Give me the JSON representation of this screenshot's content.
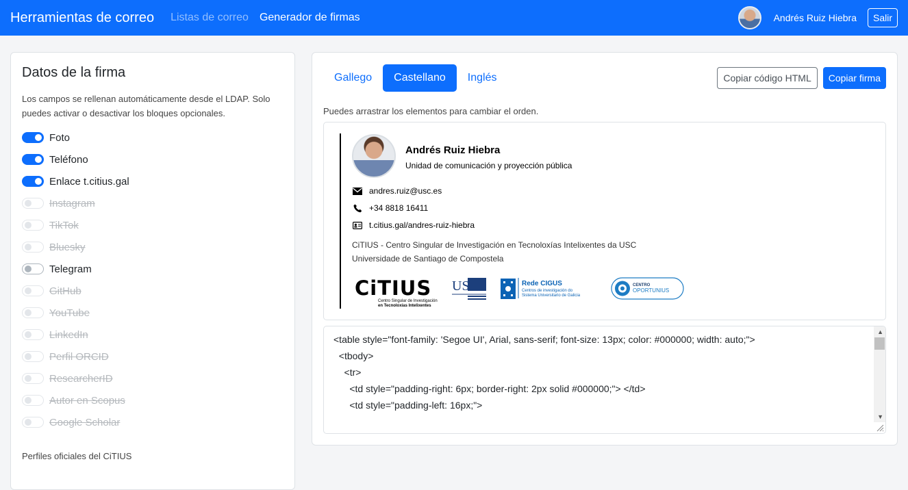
{
  "navbar": {
    "brand": "Herramientas de correo",
    "links": [
      {
        "label": "Listas de correo",
        "active": false
      },
      {
        "label": "Generador de firmas",
        "active": true
      }
    ],
    "user_name": "Andrés Ruiz Hiebra",
    "logout_label": "Salir",
    "color": "#0d6efd"
  },
  "left": {
    "title": "Datos de la firma",
    "description": "Los campos se rellenan automáticamente desde el LDAP. Solo puedes activar o desactivar los bloques opcionales.",
    "toggles": [
      {
        "label": "Foto",
        "state": "on"
      },
      {
        "label": "Teléfono",
        "state": "on"
      },
      {
        "label": "Enlace t.citius.gal",
        "state": "on"
      },
      {
        "label": "Instagram",
        "state": "disabled"
      },
      {
        "label": "TikTok",
        "state": "disabled"
      },
      {
        "label": "Bluesky",
        "state": "disabled"
      },
      {
        "label": "Telegram",
        "state": "off"
      },
      {
        "label": "GitHub",
        "state": "disabled"
      },
      {
        "label": "YouTube",
        "state": "disabled"
      },
      {
        "label": "LinkedIn",
        "state": "disabled"
      },
      {
        "label": "Perfil ORCID",
        "state": "disabled"
      },
      {
        "label": "ResearcherID",
        "state": "disabled"
      },
      {
        "label": "Autor en Scopus",
        "state": "disabled"
      },
      {
        "label": "Google Scholar",
        "state": "disabled"
      }
    ],
    "section_title": "Perfiles oficiales del CiTIUS"
  },
  "right": {
    "tabs": [
      {
        "label": "Gallego",
        "active": false
      },
      {
        "label": "Castellano",
        "active": true
      },
      {
        "label": "Inglés",
        "active": false
      }
    ],
    "copy_html_label": "Copiar código HTML",
    "copy_signature_label": "Copiar firma",
    "hint": "Puedes arrastrar los elementos para cambiar el orden.",
    "signature": {
      "name": "Andrés Ruiz Hiebra",
      "role": "Unidad de comunicación y proyección pública",
      "email": "andres.ruiz@usc.es",
      "phone": "+34 8818 16411",
      "link": "t.citius.gal/andres-ruiz-hiebra",
      "org_line1": "CiTIUS - Centro Singular de Investigación en Tecnoloxías Intelixentes da USC",
      "org_line2": "Universidade de Santiago de Compostela",
      "logos": {
        "citius_text": "CiTIUS",
        "citius_sub1": "Centro Singular de Investigación",
        "citius_sub2": "en Tecnoloxías Intelixentes",
        "usc_text": "USC",
        "cigus_title": "Rede CIGUS",
        "cigus_sub1": "Centros de investigación do",
        "cigus_sub2": "Sistema Universitario de Galicia",
        "oportunius_top": "CENTRO",
        "oportunius_bottom": "OPORTUNIUS"
      }
    },
    "code_lines": [
      "<table style=\"font-family: 'Segoe UI', Arial, sans-serif; font-size: 13px; color: #000000; width: auto;\">",
      "  <tbody>",
      "    <tr>",
      "      <td style=\"padding-right: 6px; border-right: 2px solid #000000;\"> </td>",
      "      <td style=\"padding-left: 16px;\">"
    ]
  }
}
